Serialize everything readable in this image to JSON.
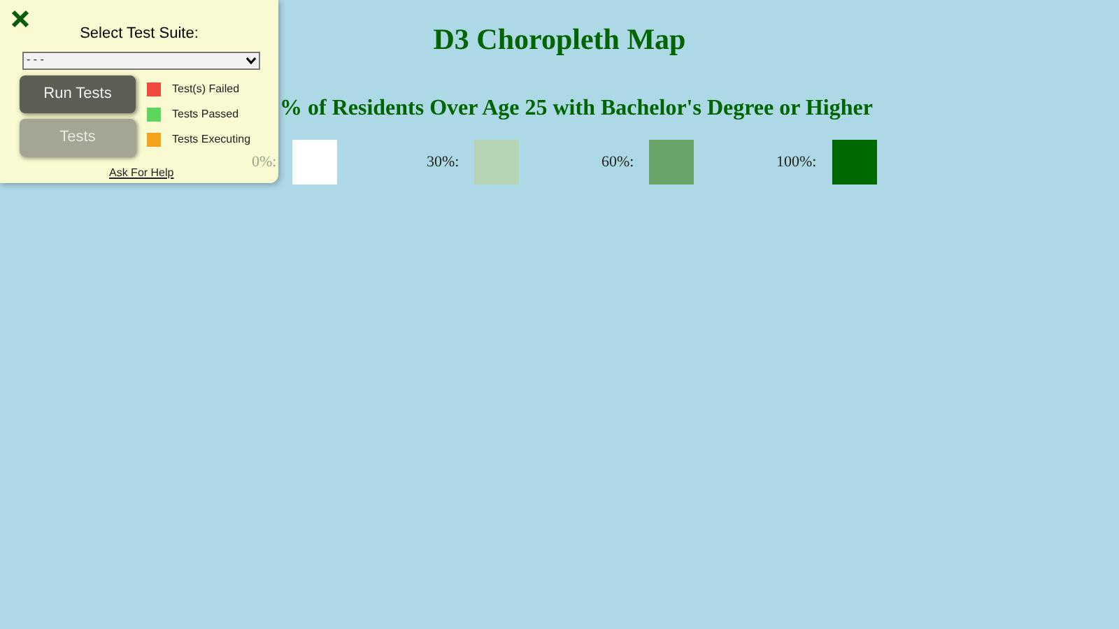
{
  "test_panel": {
    "heading": "Select Test Suite:",
    "suite_select": {
      "value": "- - -"
    },
    "buttons": [
      {
        "label": "Run Tests",
        "kind": "primary"
      },
      {
        "label": "Tests",
        "kind": "secondary"
      }
    ],
    "status_legend": [
      {
        "label": "Test(s) Failed",
        "color": "#f04a3c"
      },
      {
        "label": "Tests Passed",
        "color": "#5cd65c"
      },
      {
        "label": "Tests Executing",
        "color": "#f4a21c"
      }
    ],
    "help_link": "Ask For Help"
  },
  "title": "D3 Choropleth Map",
  "subtitle": "% of Residents Over Age 25 with Bachelor's Degree or Higher",
  "color_legend": [
    {
      "label": "0%:",
      "color": "#ffffff"
    },
    {
      "label": "30%:",
      "color": "#b6d4b3"
    },
    {
      "label": "60%:",
      "color": "#68a468"
    },
    {
      "label": "100%:",
      "color": "#006800"
    }
  ]
}
